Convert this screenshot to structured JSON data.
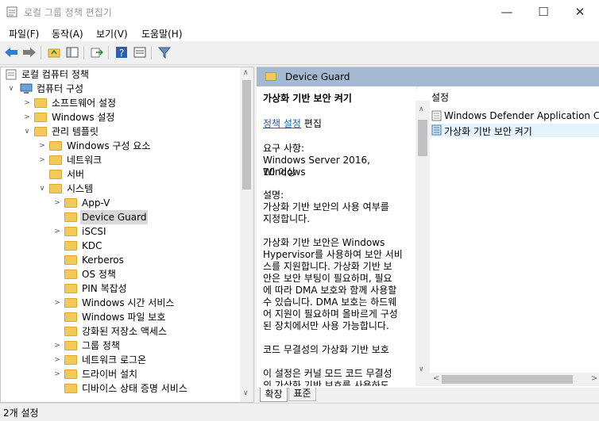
{
  "window": {
    "title": "로컬 그룹 정책 편집기",
    "minimize": "—",
    "maximize": "☐",
    "close": "✕"
  },
  "menu": [
    "파일(F)",
    "동작(A)",
    "보기(V)",
    "도움말(H)"
  ],
  "toolbar": {
    "buttons": [
      "back-arrow-icon",
      "forward-arrow-icon",
      "folder-up-icon",
      "show-hide-tree-icon",
      "export-list-icon",
      "help-icon",
      "properties-icon",
      "filter-icon"
    ]
  },
  "tree": {
    "items": [
      {
        "label": "로컬 컴퓨터 정책"
      },
      {
        "label": "컴퓨터 구성"
      },
      {
        "label": "소프트웨어 설정"
      },
      {
        "label": "Windows 설정"
      },
      {
        "label": "관리 템플릿"
      },
      {
        "label": "Windows 구성 요소"
      },
      {
        "label": "네트워크"
      },
      {
        "label": "서버"
      },
      {
        "label": "시스템"
      },
      {
        "label": "App-V"
      },
      {
        "label": "Device Guard"
      },
      {
        "label": "iSCSI"
      },
      {
        "label": "KDC"
      },
      {
        "label": "Kerberos"
      },
      {
        "label": "OS 정책"
      },
      {
        "label": "PIN 복잡성"
      },
      {
        "label": "Windows 시간 서비스"
      },
      {
        "label": "Windows 파일 보호"
      },
      {
        "label": "강화된 저장소 액세스"
      },
      {
        "label": "그룹 정책"
      },
      {
        "label": "네트워크 로그온"
      },
      {
        "label": "드라이버 설치"
      },
      {
        "label": "디바이스 상태 증명 서비스"
      }
    ]
  },
  "right": {
    "header": "Device Guard",
    "description": {
      "title": "가상화 기반 보안 켜기",
      "edit_link": "정책 설정",
      "edit_suffix": " 편집",
      "req_label": "요구 사항:",
      "req_text1": "Windows Server 2016, Windows",
      "req_text2": "10 이상",
      "desc_label": "설명:",
      "desc1": "가상화 기반 보안의 사용 여부를",
      "desc2": "지정합니다.",
      "p1": "가상화 기반 보안은 Windows",
      "p2": "Hypervisor를 사용하여 보안 서비",
      "p3": "스를 지원합니다. 가상화 기반 보",
      "p4": "안은 보안 부팅이 필요하며, 필요",
      "p5": "에 따라 DMA 보호와 함께 사용할",
      "p6": "수 있습니다. DMA 보호는 하드웨",
      "p7": "어 지원이 필요하며 올바르게 구성",
      "p8": "된 장치에서만 사용 가능합니다.",
      "code_title": "코드 무결성의 가상화 기반 보호",
      "c1": "이 설정은 커널 모드 코드 무결성",
      "c2": "의 가상화 기반 보호를 사용하도"
    },
    "list": {
      "column": "설정",
      "items": [
        "Windows Defender Application Con",
        "가상화 기반 보안 켜기"
      ]
    },
    "tabs": [
      "확장",
      "표준"
    ]
  },
  "status": "2개 설정"
}
